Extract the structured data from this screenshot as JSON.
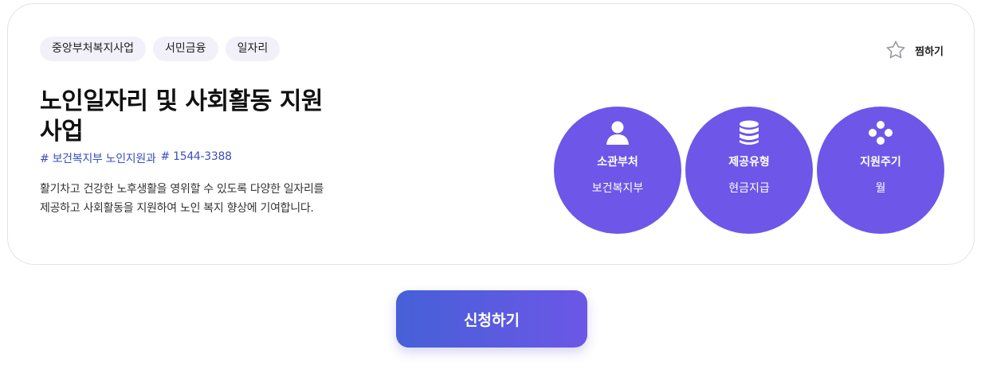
{
  "tags": [
    "중앙부처복지사업",
    "서민금융",
    "일자리"
  ],
  "favorite": {
    "label": "찜하기",
    "icon": "star-outline-icon"
  },
  "title": "노인일자리 및 사회활동 지원 사업",
  "contact": {
    "department": "# 보건복지부 노인지원과",
    "phone": "# 1544-3388"
  },
  "description": "활기차고 건강한 노후생활을 영위할 수 있도록 다양한 일자리를 제공하고 사회활동을 지원하여 노인 복지 향상에 기여합니다.",
  "info": [
    {
      "label": "소관부처",
      "value": "보건복지부",
      "icon": "person-icon"
    },
    {
      "label": "제공유형",
      "value": "현금지급",
      "icon": "database-icon"
    },
    {
      "label": "지원주기",
      "value": "월",
      "icon": "dots-diamond-icon"
    }
  ],
  "colors": {
    "accent": "#6e56e8",
    "tag_bg": "#f2f0f8",
    "link": "#3a4fbd"
  },
  "apply_label": "신청하기"
}
